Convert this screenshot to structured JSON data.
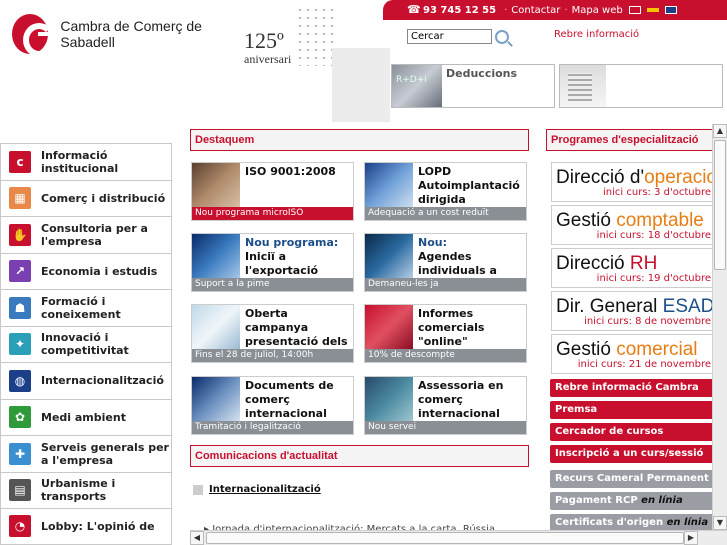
{
  "header": {
    "phone": "93 745 12 55",
    "links": [
      "Contactar",
      "Mapa web"
    ],
    "separator": "·",
    "org_name": "Cambra de Comerç de Sabadell",
    "anniversary_number": "125º",
    "anniversary_word": "aniversari",
    "search_placeholder": "Cercar",
    "info_link": "Rebre informació",
    "promo_left_label": "Deduccions",
    "promo_left_thumb_text": "R+D+i"
  },
  "left_nav": [
    {
      "label": "Informació institucional",
      "icon": "cambra-logo-icon",
      "color": "#c8102e"
    },
    {
      "label": "Comerç i distribució",
      "icon": "shop-icon",
      "color": "#e8894a"
    },
    {
      "label": "Consultoria per a l'empresa",
      "icon": "handshake-icon",
      "color": "#c8102e"
    },
    {
      "label": "Economia i estudis",
      "icon": "chart-icon",
      "color": "#7a3fb0"
    },
    {
      "label": "Formació i coneixement",
      "icon": "student-icon",
      "color": "#3a7bbf"
    },
    {
      "label": "Innovació i competitivitat",
      "icon": "innovation-icon",
      "color": "#2aa0b8"
    },
    {
      "label": "Internacionalització",
      "icon": "globe-icon",
      "color": "#1c3f8a"
    },
    {
      "label": "Medi ambient",
      "icon": "leaf-icon",
      "color": "#2e9a3a"
    },
    {
      "label": "Serveis generals per a l'empresa",
      "icon": "puzzle-icon",
      "color": "#3a8fd0"
    },
    {
      "label": "Urbanisme i transports",
      "icon": "map-icon",
      "color": "#555555"
    },
    {
      "label": "Lobby: L'opinió de",
      "icon": "lobby-icon",
      "color": "#c8102e"
    }
  ],
  "destaquem": {
    "title": "Destaquem",
    "tiles": [
      {
        "text": "ISO 9001:2008",
        "highlight": "",
        "caption": "Nou programa microISO",
        "cap_color": "red"
      },
      {
        "text": "LOPD Autoimplantació dirigida",
        "highlight": "",
        "caption": "Adequació a un cost reduït",
        "cap_color": "grey"
      },
      {
        "text": "Iniciï a l'exportació",
        "highlight": "Nou programa:",
        "caption": "Suport a la pime",
        "cap_color": "grey"
      },
      {
        "text": "Agendes individuals a l'estranger",
        "highlight": "Nou:",
        "caption": "Demaneu-les ja",
        "cap_color": "grey"
      },
      {
        "text": "Oberta campanya presentació dels comptes anuals",
        "highlight": "",
        "caption": "Fins el 28 de juliol, 14:00h",
        "cap_color": "grey"
      },
      {
        "text": "Informes comercials \"online\"",
        "highlight": "",
        "caption": "10% de descompte",
        "cap_color": "grey"
      },
      {
        "text": "Documents de comerç internacional",
        "highlight": "",
        "caption": "Tramitació i legalització",
        "cap_color": "grey"
      },
      {
        "text": "Assessoria en comerç internacional",
        "highlight": "",
        "caption": "Nou servei",
        "cap_color": "grey"
      }
    ]
  },
  "comunicacions": {
    "title": "Comunicacions d'actualitat",
    "item": "Internacionalització",
    "sub": "Jornada d'internacionalització: Mercats a la carta. Rússia"
  },
  "programes": {
    "title": "Programes d'especialització",
    "items": [
      {
        "pre": "Direcció d'",
        "accent": "operacions",
        "accent_color": "orange",
        "date": "inici curs: 3 d'octubre"
      },
      {
        "pre": "Gestió ",
        "accent": "comptable",
        "accent_color": "orange",
        "date": "inici curs: 18 d'octubre"
      },
      {
        "pre": "Direcció ",
        "accent": "RH",
        "accent_color": "red",
        "date": "inici curs: 19 d'octubre"
      },
      {
        "pre": "Dir. General ",
        "accent": "ESADE",
        "accent_color": "blue",
        "date": "inici curs: 8 de novembre"
      },
      {
        "pre": "Gestió ",
        "accent": "comercial",
        "accent_color": "orange",
        "date": "inici curs: 21 de novembre"
      }
    ]
  },
  "right_buttons": [
    {
      "label": "Rebre informació Cambra",
      "italic": "",
      "color": "red"
    },
    {
      "label": "Premsa",
      "italic": "",
      "color": "red"
    },
    {
      "label": "Cercador de cursos",
      "italic": "",
      "color": "red"
    },
    {
      "label": "Inscripció a un curs/sessió",
      "italic": "",
      "color": "red"
    },
    {
      "label": "Recurs Cameral Permanent",
      "italic": "",
      "color": "grey"
    },
    {
      "label": "Pagament RCP ",
      "italic": "en línia",
      "color": "grey"
    },
    {
      "label": "Certificats d'origen ",
      "italic": "en línia",
      "color": "grey"
    }
  ]
}
